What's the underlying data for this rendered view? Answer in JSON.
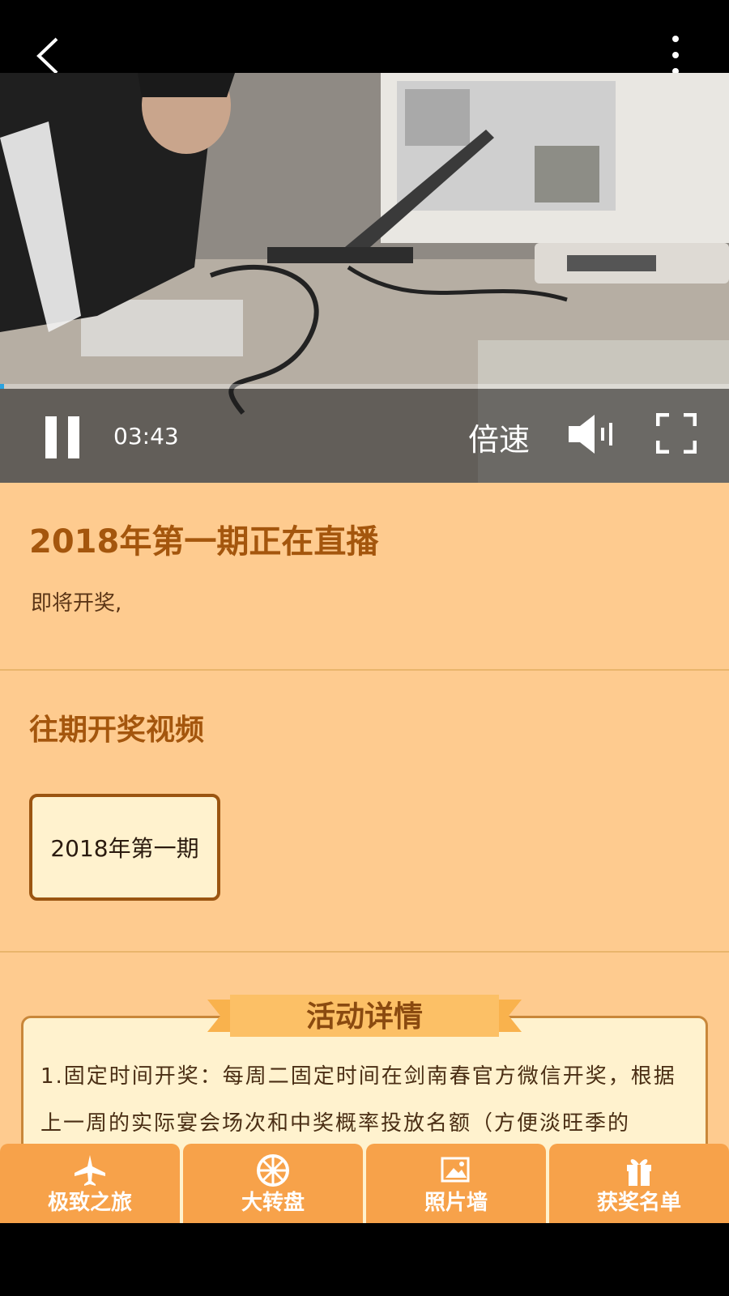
{
  "player": {
    "time": "03:43",
    "speed_label": "倍速",
    "progress_fraction": 0.005
  },
  "live": {
    "title": "2018年第一期正在直播",
    "description": "即将开奖,"
  },
  "past": {
    "title": "往期开奖视频",
    "episodes": [
      "2018年第一期"
    ]
  },
  "details": {
    "title": "活动详情",
    "text": "1.固定时间开奖：每周二固定时间在剑南春官方微信开奖，根据上一周的实际宴会场次和中奖概率投放名额（方便淡旺季的"
  },
  "nav": [
    {
      "label": "极致之旅",
      "icon": "airplane-icon"
    },
    {
      "label": "大转盘",
      "icon": "wheel-icon"
    },
    {
      "label": "照片墙",
      "icon": "photo-icon"
    },
    {
      "label": "获奖名单",
      "icon": "gift-icon"
    }
  ],
  "colors": {
    "content_bg": "#fecb8f",
    "title_brown": "#a4560d",
    "nav_orange": "#f7a24a",
    "progress_blue": "#2aa3e0"
  }
}
